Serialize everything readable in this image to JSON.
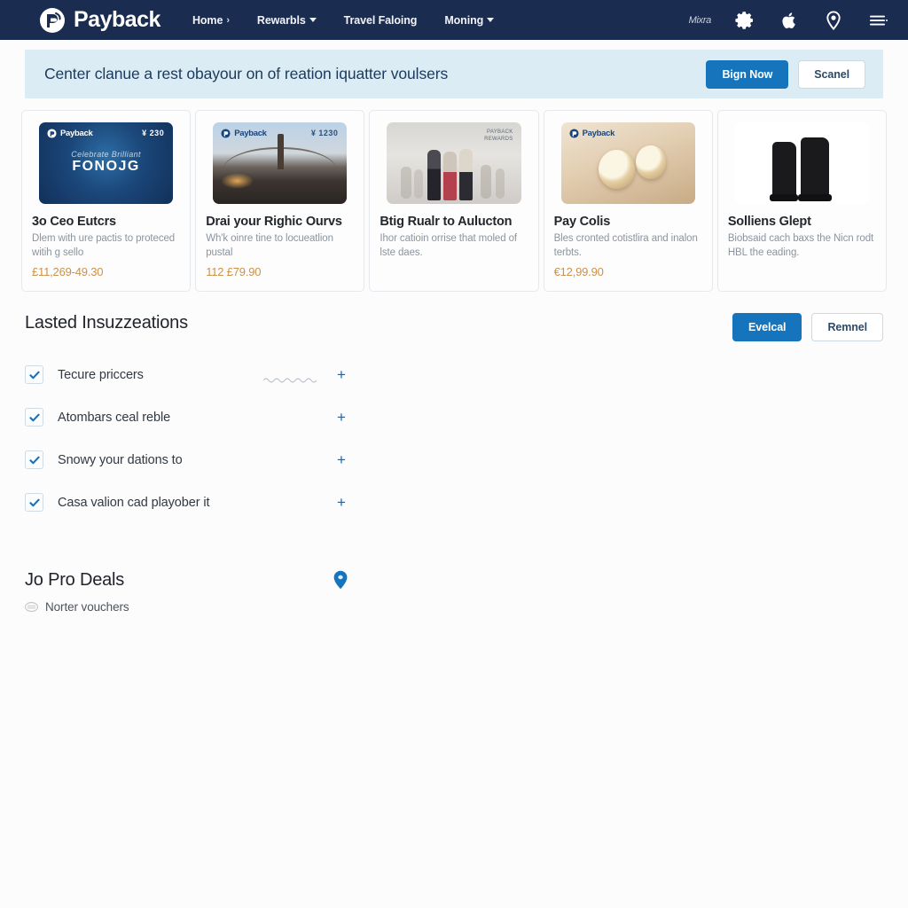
{
  "header": {
    "brand": "Payback",
    "brand_icon": "payback-logo-icon",
    "nav": [
      {
        "label": "Home",
        "icon": "chevron-right-icon",
        "has_caret": false
      },
      {
        "label": "Rewarbls",
        "icon": "chevron-down-icon",
        "has_caret": true
      },
      {
        "label": "Travel Faloing",
        "icon": "",
        "has_caret": false
      },
      {
        "label": "Moning",
        "icon": "chevron-down-icon",
        "has_caret": true
      }
    ],
    "user_label": "Mixra",
    "icons": [
      "gear-icon",
      "apple-icon",
      "location-pin-icon",
      "hamburger-menu-icon"
    ],
    "background_color": "#1b2c51"
  },
  "banner": {
    "text": "Center clanue a rest obayour on of reation iquatter voulsers",
    "primary_label": "Bign Now",
    "secondary_label": "Scanel",
    "background_color": "#dcecf4",
    "primary_color": "#1574bb"
  },
  "cards": [
    {
      "title": "3o Ceo Eutcrs",
      "desc": "Dlem with ure pactis to proteced witih g sello",
      "price": "£11,269-49.30",
      "art": "gift-card-blue",
      "art_logo": "Payback",
      "art_value": "¥ 230",
      "art_script": "Celebrate Brilliant",
      "art_big": "FONOJG"
    },
    {
      "title": "Drai your Righic Ourvs",
      "desc": "Wh'k oinre tine to locueatlion pustal",
      "price": "112 £79.90",
      "art": "bridge-sunset",
      "art_logo": "Payback",
      "art_value": "¥ 1230",
      "art_script": "",
      "art_big": ""
    },
    {
      "title": "Btig Rualr to Aulucton",
      "desc": "Ihor catioin orrise that moled of lste daes.",
      "price": "",
      "art": "people-walking",
      "art_logo": "",
      "art_value": "",
      "art_stamp": "PAYBACK\\nREWARDS",
      "art_script": "",
      "art_big": ""
    },
    {
      "title": "Pay Colis",
      "desc": "Bles cronted cotistlira and inalon terbts.",
      "price": "€12,99.90",
      "art": "food-pastry",
      "art_logo": "Payback",
      "art_value": "",
      "art_script": "",
      "art_big": ""
    },
    {
      "title": "Solliens Glept",
      "desc": "Biobsaid cach baxs the Nicn rodt HBL the eading.",
      "price": "",
      "art": "black-boots",
      "art_logo": "",
      "art_value": "",
      "art_script": "",
      "art_big": ""
    }
  ],
  "checklist_section": {
    "title": "Lasted Insuzzeations",
    "primary_label": "Evelcal",
    "secondary_label": "Remnel",
    "items": [
      {
        "label": "Tecure priccers",
        "checked": true,
        "has_squiggle": true,
        "add_label": "+"
      },
      {
        "label": "Atombars ceal reble",
        "checked": true,
        "has_squiggle": false,
        "add_label": "+"
      },
      {
        "label": "Snowy your dations to",
        "checked": true,
        "has_squiggle": false,
        "add_label": "+"
      },
      {
        "label": "Casa valion cad playober it",
        "checked": true,
        "has_squiggle": false,
        "add_label": "+"
      }
    ]
  },
  "deals_section": {
    "title": "Jo Pro Deals",
    "pin_icon": "location-pin-icon",
    "sub_icon": "voucher-icon",
    "sub_label": "Norter vouchers",
    "pin_color": "#1574bb"
  }
}
